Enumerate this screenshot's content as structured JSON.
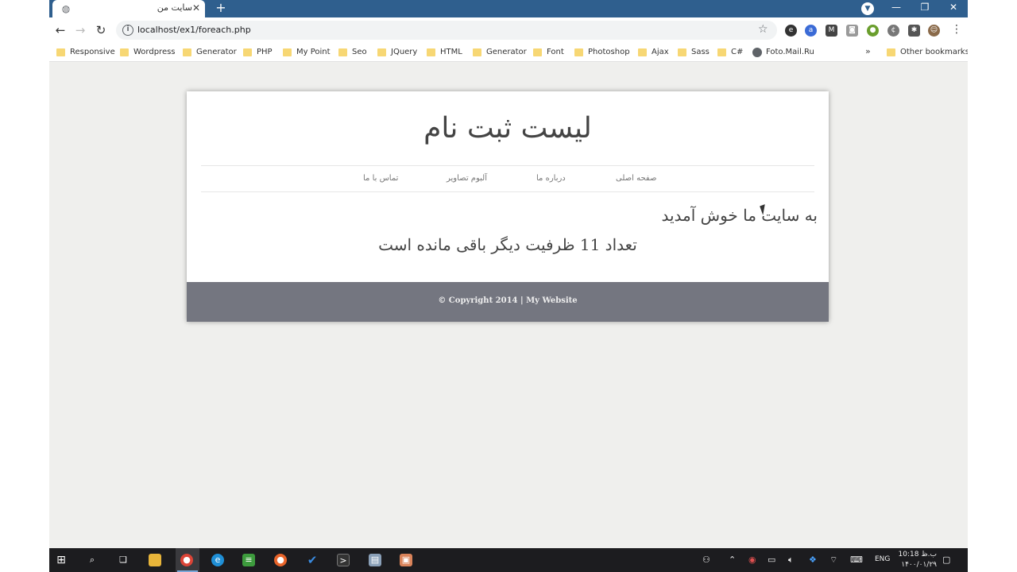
{
  "browser": {
    "tab_title": "سایت من",
    "url": "localhost/ex1/foreach.php",
    "bookmarks": [
      "Responsive",
      "Wordpress",
      "Generator",
      "PHP",
      "My Point",
      "Seo",
      "JQuery",
      "HTML",
      "Generator",
      "Font",
      "Photoshop",
      "Ajax",
      "Sass",
      "C#",
      "Foto.Mail.Ru"
    ],
    "more_bookmarks": "»",
    "other_bookmarks": "Other bookmarks"
  },
  "site": {
    "title": "لیست ثبت نام",
    "nav": [
      "صفحه اصلی",
      "درباره ما",
      "آلبوم تصاویر",
      "تماس با ما"
    ],
    "welcome": "به سایت ما خوش آمدید",
    "capacity": "تعداد 11 ظرفیت دیگر باقی مانده است",
    "copyright": "© Copyright 2014 | My Website"
  },
  "taskbar": {
    "language": "ENG",
    "time": "10:18 ب.ظ",
    "date": "۱۴۰۰/۰۱/۲۹"
  },
  "colors": {
    "tab_bar": "#2f5f8e",
    "footer": "#747680",
    "page_bg": "#efefed"
  }
}
